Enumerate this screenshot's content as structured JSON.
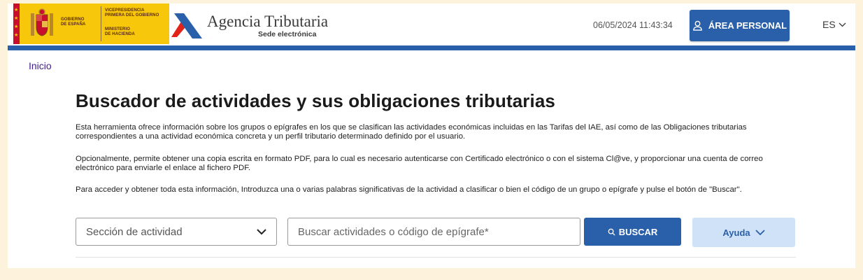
{
  "header": {
    "gov_line1": "GOBIERNO",
    "gov_line2": "DE ESPAÑA",
    "gov_line3": "VICEPRESIDENCIA",
    "gov_line4": "PRIMERA DEL GOBIERNO",
    "gov_line5": "MINISTERIO",
    "gov_line6": "DE HACIENDA",
    "agency_title": "Agencia Tributaria",
    "agency_subtitle": "Sede electrónica",
    "datetime": "06/05/2024 11:43:34",
    "area_personal": "ÁREA PERSONAL",
    "language": "ES"
  },
  "breadcrumb": {
    "home": "Inicio"
  },
  "main": {
    "title": "Buscador de actividades y sus obligaciones tributarias",
    "paragraph1": "Esta herramienta ofrece información sobre los grupos o epígrafes en los que se clasifican las actividades económicas incluidas en las Tarifas del IAE, así como de las Obligaciones tributarias correspondientes a una actividad económica concreta y un perfil tributario determinado definido por el usuario.",
    "paragraph2": "Opcionalmente, permite obtener una copia escrita en formato PDF, para lo cual es necesario autenticarse con Certificado electrónico o con el sistema Cl@ve, y proporcionar una cuenta de correo electrónico para enviarle el enlace al fichero PDF.",
    "paragraph3": "Para acceder y obtener toda esta información, Introduzca una o varias palabras significativas de la actividad a clasificar o bien el código de un grupo o epígrafe y pulse el botón de \"Buscar\"."
  },
  "search": {
    "section_select": "Sección de actividad",
    "placeholder": "Buscar actividades o código de epígrafe*",
    "button": "BUSCAR",
    "help": "Ayuda"
  },
  "colors": {
    "primary": "#2a60aa",
    "gov_yellow": "#f6c70b",
    "help_bg": "#cfe2f7",
    "breadcrumb": "#3d1f8a"
  }
}
